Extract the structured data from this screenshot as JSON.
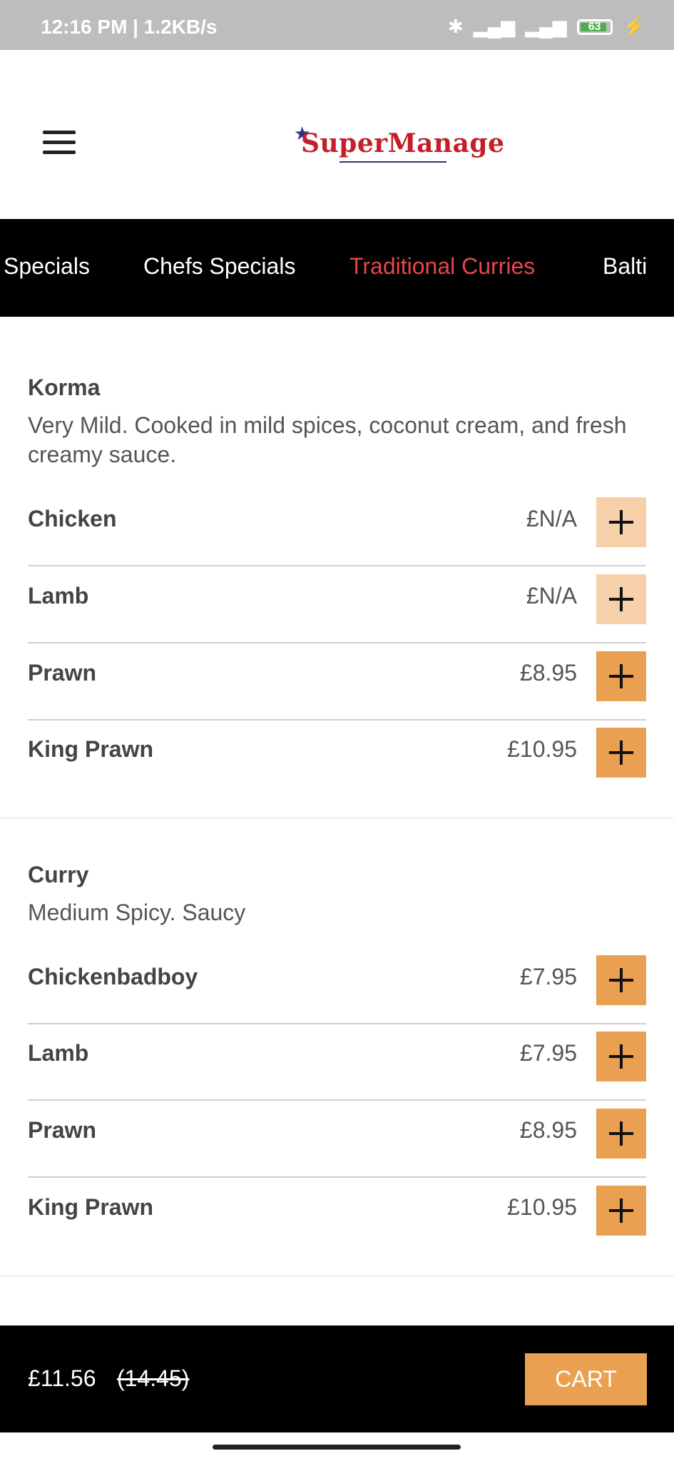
{
  "status_bar": {
    "time": "12:16 PM | 1.2KB/s",
    "battery": "63"
  },
  "app_bar": {
    "logo_text": "SuperManage"
  },
  "tabs": [
    {
      "label": "Specials"
    },
    {
      "label": "Chefs Specials"
    },
    {
      "label": "Traditional Curries",
      "active": true
    },
    {
      "label": "Balti"
    }
  ],
  "sections": [
    {
      "title": "Korma",
      "description": "Very Mild. Cooked in mild spices, coconut cream, and fresh creamy sauce.",
      "items": [
        {
          "name": "Chicken",
          "price": "£N/A",
          "available": false
        },
        {
          "name": "Lamb",
          "price": "£N/A",
          "available": false
        },
        {
          "name": "Prawn",
          "price": "£8.95",
          "available": true
        },
        {
          "name": "King Prawn",
          "price": "£10.95",
          "available": true
        }
      ]
    },
    {
      "title": "Curry",
      "description": "Medium Spicy. Saucy",
      "items": [
        {
          "name": "Chickenbadboy",
          "price": "£7.95",
          "available": true
        },
        {
          "name": "Lamb",
          "price": "£7.95",
          "available": true
        },
        {
          "name": "Prawn",
          "price": "£8.95",
          "available": true
        },
        {
          "name": "King Prawn",
          "price": "£10.95",
          "available": true
        }
      ]
    }
  ],
  "cart": {
    "total": "£11.56",
    "original_total": "(14.45)",
    "button_label": "CART"
  },
  "colors": {
    "accent": "#e9a050",
    "active_tab": "#e8474b",
    "tab_bar": "#000000"
  }
}
